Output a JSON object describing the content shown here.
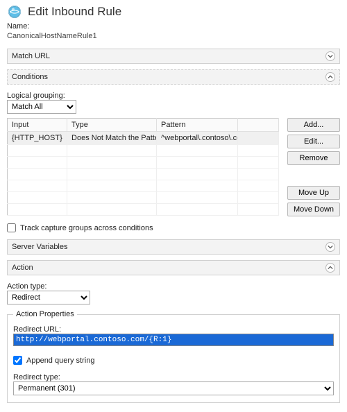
{
  "header": {
    "title": "Edit Inbound Rule"
  },
  "name": {
    "label": "Name:",
    "value": "CanonicalHostNameRule1"
  },
  "match_url": {
    "caption": "Match URL",
    "expanded": false
  },
  "conditions": {
    "caption": "Conditions",
    "expanded": true,
    "logical_label": "Logical grouping:",
    "logical_value": "Match All",
    "columns": [
      "Input",
      "Type",
      "Pattern"
    ],
    "rows": [
      {
        "input": "{HTTP_HOST}",
        "type": "Does Not Match the Pattern",
        "pattern": "^webportal\\.contoso\\.com$"
      }
    ],
    "buttons": {
      "add": "Add...",
      "edit": "Edit...",
      "remove": "Remove",
      "up": "Move Up",
      "down": "Move Down"
    },
    "track_label": "Track capture groups across conditions",
    "track_checked": false
  },
  "server_vars": {
    "caption": "Server Variables",
    "expanded": false
  },
  "action": {
    "caption": "Action",
    "expanded": true,
    "type_label": "Action type:",
    "type_value": "Redirect",
    "props_legend": "Action Properties",
    "redirect_url_label": "Redirect URL:",
    "redirect_url_value": "http://webportal.contoso.com/{R:1}",
    "append_label": "Append query string",
    "append_checked": true,
    "redirect_type_label": "Redirect type:",
    "redirect_type_value": "Permanent (301)"
  }
}
